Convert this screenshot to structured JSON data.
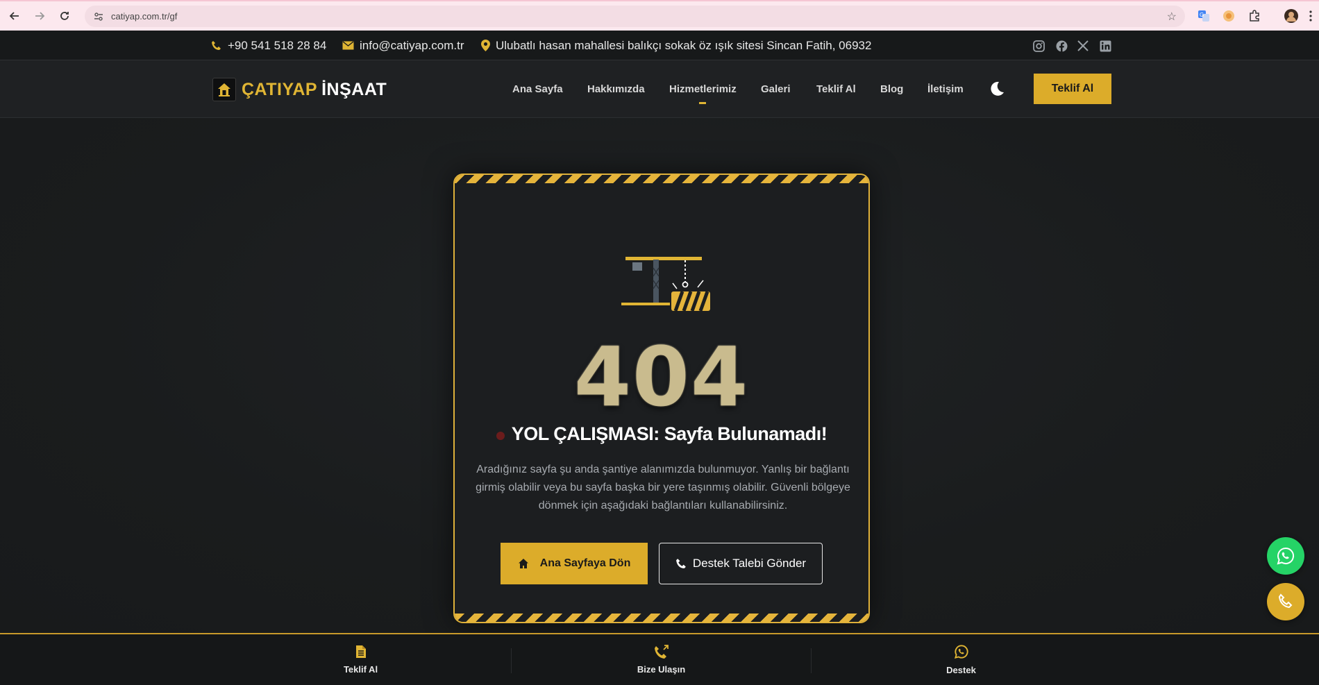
{
  "browser": {
    "url": "catiyap.com.tr/gf"
  },
  "topbar": {
    "phone": "+90 541 518 28 84",
    "email": "info@catiyap.com.tr",
    "address": "Ulubatlı hasan mahallesi balıkçı sokak öz ışık sitesi Sincan Fatih, 06932",
    "social_icons": [
      "instagram-icon",
      "facebook-icon",
      "x-icon",
      "linkedin-icon"
    ]
  },
  "navbar": {
    "logo_part1": "ÇATIYAP",
    "logo_part2": "İNŞAAT",
    "menu": [
      {
        "label": "Ana Sayfa"
      },
      {
        "label": "Hakkımızda"
      },
      {
        "label": "Hizmetlerimiz",
        "active": true
      },
      {
        "label": "Galeri"
      },
      {
        "label": "Teklif Al"
      },
      {
        "label": "Blog"
      },
      {
        "label": "İletişim"
      }
    ],
    "cta": "Teklif Al"
  },
  "error": {
    "code": "404",
    "title": "YOL ÇALIŞMASI: Sayfa Bulunamadı!",
    "description": "Aradığınız sayfa şu anda şantiye alanımızda bulunmuyor. Yanlış bir bağlantı girmiş olabilir veya bu sayfa başka bir yere taşınmış olabilir. Güvenli bölgeye dönmek için aşağıdaki bağlantıları kullanabilirsiniz.",
    "home_button": "Ana Sayfaya Dön",
    "support_button": "Destek Talebi Gönder"
  },
  "bottombar": {
    "items": [
      {
        "label": "Teklif Al",
        "icon": "document-icon"
      },
      {
        "label": "Bize Ulaşın",
        "icon": "phone-outgoing-icon"
      },
      {
        "label": "Destek",
        "icon": "whatsapp-icon"
      }
    ]
  },
  "colors": {
    "accent": "#dcac2a",
    "background": "#1a1c1d",
    "whatsapp": "#25d366"
  }
}
